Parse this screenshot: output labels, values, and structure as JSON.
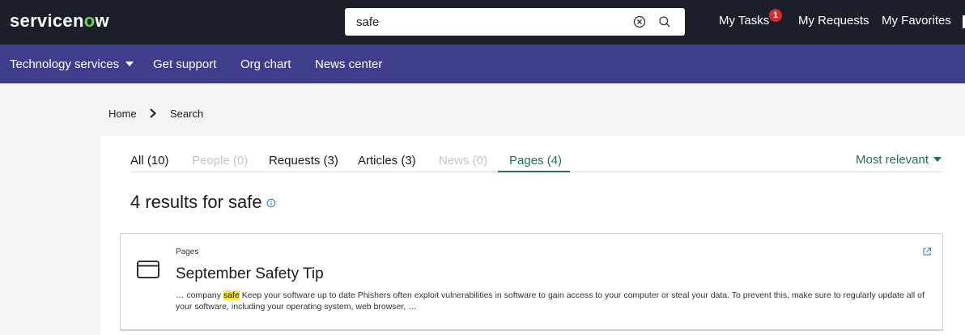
{
  "header": {
    "logo": {
      "part1": "servicen",
      "ring": "o",
      "part2": "w"
    },
    "search": {
      "value": "safe",
      "placeholder": ""
    },
    "links": {
      "my_tasks": "My Tasks",
      "my_tasks_count": "1",
      "my_requests": "My Requests",
      "my_favorites": "My Favorites"
    }
  },
  "nav": {
    "technology_services": "Technology services",
    "get_support": "Get support",
    "org_chart": "Org chart",
    "news_center": "News center"
  },
  "breadcrumb": {
    "home": "Home",
    "current": "Search"
  },
  "tabs": {
    "all": "All (10)",
    "people": "People (0)",
    "requests": "Requests (3)",
    "articles": "Articles (3)",
    "news": "News (0)",
    "pages": "Pages (4)"
  },
  "sort": {
    "label": "Most relevant"
  },
  "results": {
    "heading": "4 results for safe",
    "items": [
      {
        "kind": "Pages",
        "title": "September Safety Tip",
        "snippet_before": "… company ",
        "snippet_highlight": "safe",
        "snippet_after": " Keep your software up to date Phishers often exploit vulnerabilities in software to gain access to your computer or steal your data. To prevent this, make sure to regularly update all of your software, including your operating system, web browser, …"
      }
    ]
  },
  "colors": {
    "topbar": "#1c1f2a",
    "navbar": "#3e3e8c",
    "accent": "#1f6f5c",
    "logo_ring": "#62d84e",
    "badge": "#d32f2f",
    "highlight": "#f7e33b"
  },
  "icons": {
    "clear": "clear-circle-x-icon",
    "search": "search-icon",
    "breadcrumb_separator": "chevron-right-icon",
    "info": "info-icon",
    "page": "browser-window-icon",
    "external": "external-link-icon"
  }
}
